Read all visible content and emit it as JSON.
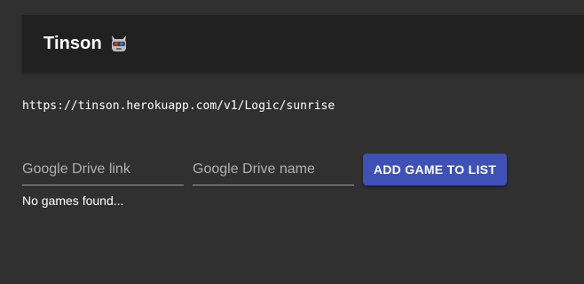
{
  "header": {
    "title": "Tinson",
    "logo_icon": "robot-devil-icon"
  },
  "api_url": "https://tinson.herokuapp.com/v1/Logic/sunrise",
  "form": {
    "link_placeholder": "Google Drive link",
    "name_placeholder": "Google Drive name",
    "link_value": "",
    "name_value": "",
    "add_button_label": "ADD GAME TO LIST"
  },
  "games": {
    "empty_message": "No games found..."
  },
  "colors": {
    "background": "#303030",
    "app_bar": "#212121",
    "primary": "#3f51b5"
  }
}
